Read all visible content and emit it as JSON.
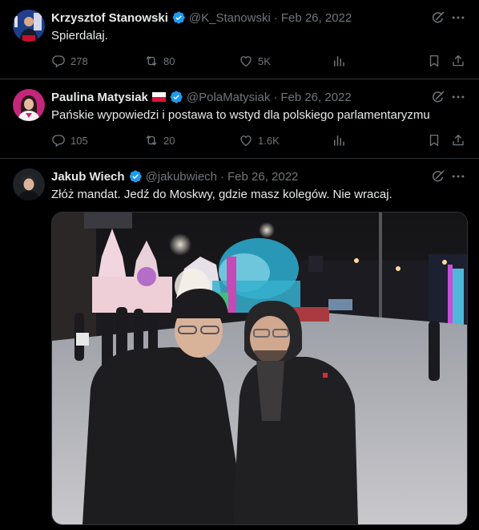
{
  "tweets": [
    {
      "name": "Krzysztof Stanowski",
      "handle": "@K_Stanowski",
      "separator": "·",
      "date": "Feb 26, 2022",
      "text": "Spierdalaj.",
      "replies": "278",
      "retweets": "80",
      "likes": "5K"
    },
    {
      "name": "Paulina Matysiak",
      "handle": "@PolaMatysiak",
      "separator": "·",
      "date": "Feb 26, 2022",
      "text": "Pańskie wypowiedzi i postawa to wstyd dla polskiego parlamentaryzmu",
      "replies": "105",
      "retweets": "20",
      "likes": "1.6K"
    },
    {
      "name": "Jakub Wiech",
      "handle": "@jakubwiech",
      "separator": "·",
      "date": "Feb 26, 2022",
      "text": "Złóż mandat. Jedź do Moskwy, gdzie masz kolegów. Nie wracaj."
    }
  ],
  "colors": {
    "background": "#000000",
    "text_primary": "#e7e9ea",
    "text_secondary": "#71767b",
    "verified": "#1d9bf0",
    "divider": "#2f3336"
  },
  "icons": [
    "verified-badge-icon",
    "grok-icon",
    "more-icon",
    "reply-icon",
    "retweet-icon",
    "like-icon",
    "views-icon",
    "bookmark-icon",
    "share-icon",
    "poland-flag-icon"
  ]
}
